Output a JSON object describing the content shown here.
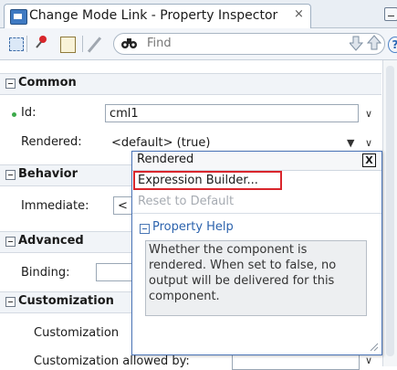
{
  "window": {
    "title": "Change Mode Link - Property Inspector",
    "close_glyph": "×"
  },
  "toolbar": {
    "find_placeholder": "Find",
    "find_icon": "binoculars-icon"
  },
  "sections": {
    "common": "Common",
    "behavior": "Behavior",
    "advanced": "Advanced",
    "customization": "Customization"
  },
  "properties": {
    "id_label": "Id:",
    "id_value": "cml1",
    "rendered_label": "Rendered:",
    "rendered_value": "<default> (true)",
    "immediate_label": "Immediate:",
    "immediate_value": "<",
    "binding_label": "Binding:",
    "customization_label": "Customization",
    "customization_allowed_label": "Customization allowed by:"
  },
  "popup": {
    "title": "Rendered",
    "close_glyph": "X",
    "expression_builder": "Expression Builder...",
    "reset_default": "Reset to Default",
    "help_title": "Property Help",
    "help_text": "Whether the component is rendered. When set to false, no output will be delivered for this component."
  },
  "colors": {
    "highlight_border": "#d9262c",
    "popup_border": "#4b75b8",
    "link_blue": "#2c63ad"
  }
}
